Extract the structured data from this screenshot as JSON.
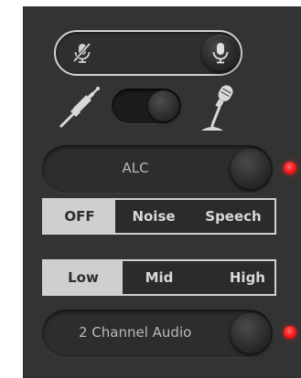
{
  "mic": {
    "muted_icon": "mic-muted-icon",
    "unmuted_icon": "mic-icon"
  },
  "input": {
    "left_icon": "audio-jack-icon",
    "right_icon": "microphone-stand-icon"
  },
  "alc": {
    "label": "ALC",
    "led_color": "#ff1a1a"
  },
  "vad": {
    "options": [
      "OFF",
      "Noise",
      "Speech"
    ],
    "selected": "OFF"
  },
  "eq": {
    "options": [
      "Low",
      "Mid",
      "High"
    ],
    "selected": "Low"
  },
  "channel": {
    "label": "2 Channel Audio",
    "led_color": "#ff1a1a"
  },
  "colors": {
    "panel": "#333333",
    "active_segment": "#cfcfcf",
    "led": "#ff1a1a"
  }
}
